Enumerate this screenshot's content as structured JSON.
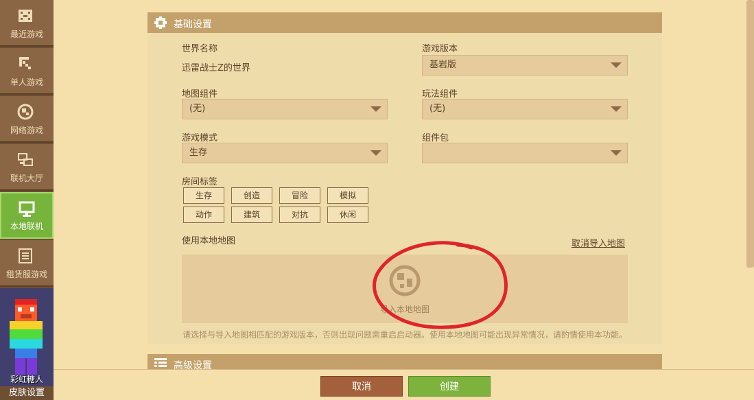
{
  "sidebar": {
    "items": [
      {
        "label": "最近游戏",
        "icon": "gamepad-icon"
      },
      {
        "label": "单人游戏",
        "icon": "pickaxe-icon"
      },
      {
        "label": "网络游戏",
        "icon": "globe-icon"
      },
      {
        "label": "联机大厅",
        "icon": "network-icon"
      },
      {
        "label": "本地联机",
        "icon": "monitor-icon",
        "active": true
      },
      {
        "label": "租赁服游戏",
        "icon": "server-list-icon"
      }
    ],
    "skin": {
      "name": "彩虹糖人",
      "button_label": "皮肤设置"
    }
  },
  "basic_settings": {
    "title": "基础设置",
    "world_name_label": "世界名称",
    "world_name_value": "迅雷战士Z的世界",
    "game_version_label": "游戏版本",
    "game_version_value": "基岩版",
    "map_component_label": "地图组件",
    "map_component_value": "(无)",
    "play_component_label": "玩法组件",
    "play_component_value": "(无)",
    "game_mode_label": "游戏模式",
    "game_mode_value": "生存",
    "component_pack_label": "组件包",
    "component_pack_value": "",
    "room_tags_label": "房间标签",
    "room_tags": [
      "生存",
      "创造",
      "冒险",
      "模拟",
      "动作",
      "建筑",
      "对抗",
      "休闲"
    ],
    "local_map_label": "使用本地地图",
    "cancel_import_label": "取消导入地图",
    "import_map_label": "导入本地地图",
    "hint": "请选择与导入地图相匹配的游戏版本，否则出现问题需重启启动器。使用本地地图可能出现异常情况，请酌情使用本功能。"
  },
  "advanced_settings": {
    "title": "高级设置"
  },
  "footer": {
    "cancel_label": "取消",
    "create_label": "创建"
  },
  "colors": {
    "accent_green": "#7db23d",
    "cancel_brown": "#a3603b",
    "header_tan": "#c4a06a",
    "annotation_red": "#e0242a"
  }
}
